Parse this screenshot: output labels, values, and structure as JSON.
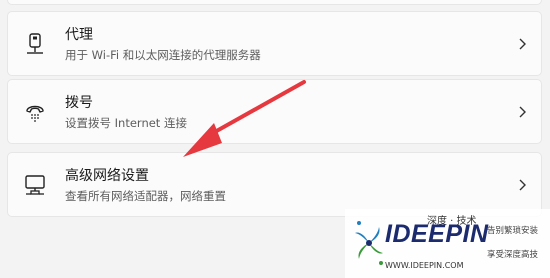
{
  "settings": {
    "items": [
      {
        "title": "代理",
        "subtitle": "用于 Wi-Fi 和以太网连接的代理服务器",
        "icon": "proxy-icon"
      },
      {
        "title": "拨号",
        "subtitle": "设置拨号 Internet 连接",
        "icon": "dial-up-icon"
      },
      {
        "title": "高级网络设置",
        "subtitle": "查看所有网络适配器，网络重置",
        "icon": "advanced-network-icon"
      }
    ]
  },
  "annotation": {
    "color": "#e5393f",
    "icon": "red-arrow-pointer"
  },
  "watermark": {
    "brand": "IDEEPIN",
    "cn_title": "深度 · 技术",
    "slogan_1": "告别繁琐安装",
    "slogan_2": "享受深度高技",
    "url": "WWW.IDEEPIN.COM"
  }
}
